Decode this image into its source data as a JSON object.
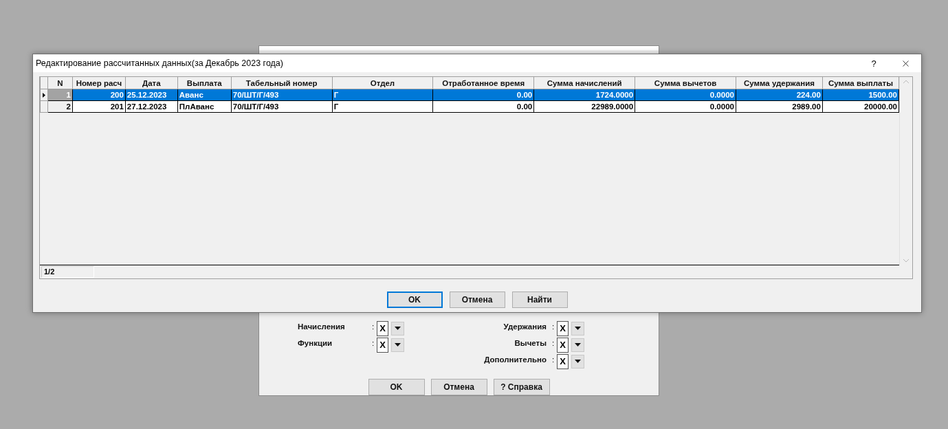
{
  "background_window": {
    "left_filters": [
      {
        "label": "Начисления",
        "colon": ":",
        "value": "X"
      },
      {
        "label": "Функции",
        "colon": ":",
        "value": "X"
      }
    ],
    "right_filters": [
      {
        "label": "Удержания",
        "colon": ":",
        "value": "X"
      },
      {
        "label": "Вычеты",
        "colon": ":",
        "value": "X"
      },
      {
        "label": "Дополнительно",
        "colon": ":",
        "value": "X"
      }
    ],
    "buttons": [
      "OK",
      "Отмена",
      "? Справка"
    ]
  },
  "dialog": {
    "title": "Редактирование рассчитанных данных(за Декабрь 2023 года)",
    "help_button": "?",
    "table": {
      "columns": [
        "N",
        "Номер расч",
        "Дата",
        "Выплата",
        "Табельный номер",
        "Отдел",
        "Отработанное время",
        "Сумма начислений",
        "Сумма вычетов",
        "Сумма удержания",
        "Сумма выплаты"
      ],
      "rows": [
        {
          "selected": true,
          "cells": [
            "1",
            "200",
            "25.12.2023",
            "Аванс",
            "70/ШТ/Г/493",
            "Г",
            "0.00",
            "1724.0000",
            "0.0000",
            "224.00",
            "1500.00"
          ]
        },
        {
          "selected": false,
          "cells": [
            "2",
            "201",
            "27.12.2023",
            "ПлАванс",
            "70/ШТ/Г/493",
            "Г",
            "0.00",
            "22989.0000",
            "0.0000",
            "2989.00",
            "20000.00"
          ]
        }
      ]
    },
    "record_counter": "1/2",
    "buttons": [
      {
        "label": "OK",
        "default": true
      },
      {
        "label": "Отмена",
        "default": false
      },
      {
        "label": "Найти",
        "default": false
      }
    ]
  }
}
